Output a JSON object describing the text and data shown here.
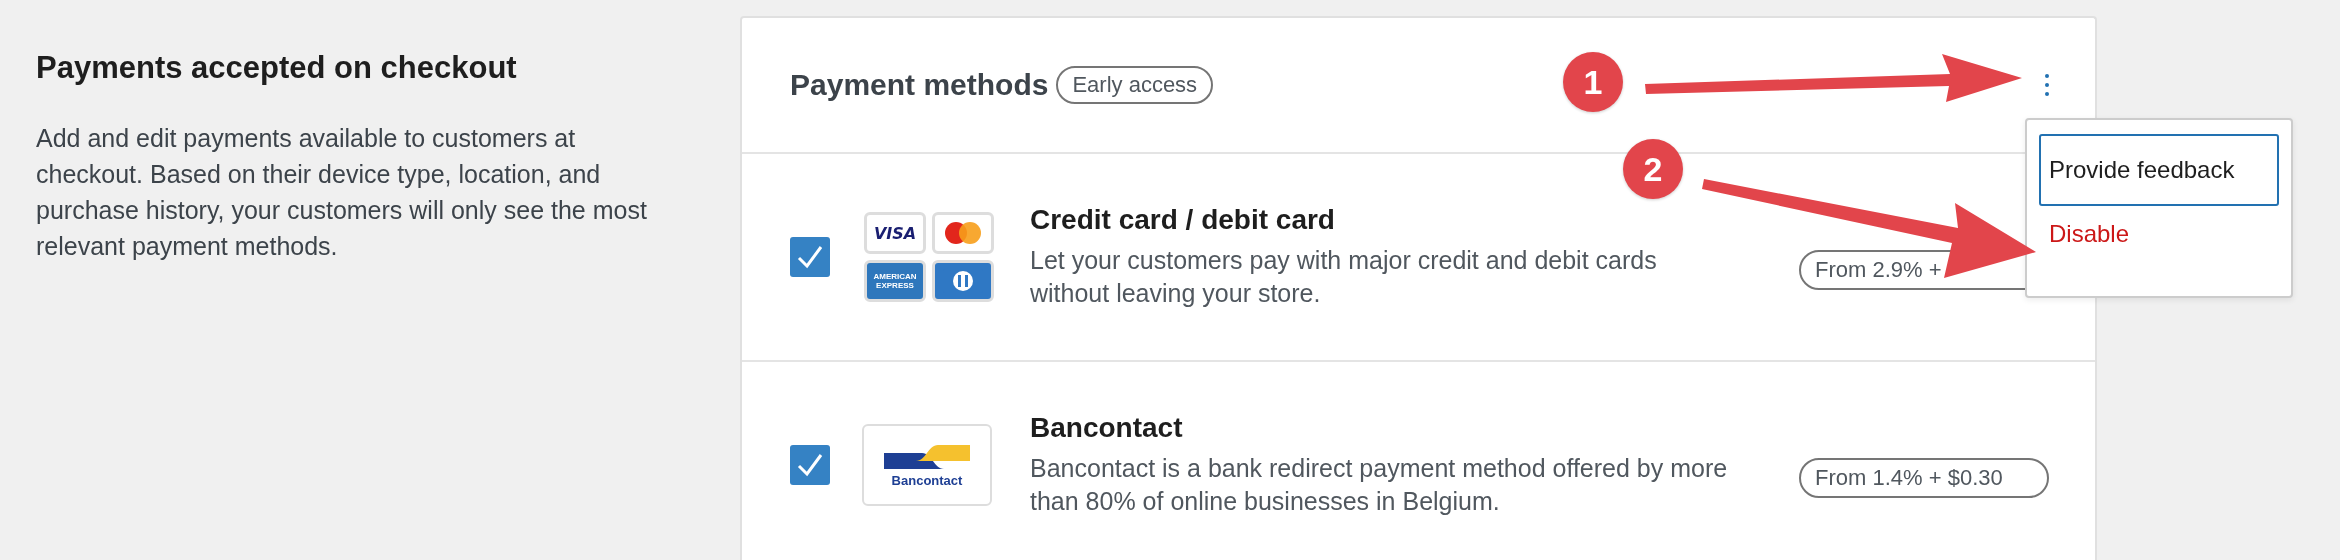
{
  "intro": {
    "title": "Payments accepted on checkout",
    "description": "Add and edit payments available to customers at checkout. Based on their device type, location, and purchase history, your customers will only see the most relevant payment methods."
  },
  "card": {
    "title": "Payment methods",
    "badge": "Early access",
    "methods": [
      {
        "name": "Credit card / debit card",
        "description": "Let your customers pay with major credit and debit cards without leaving your store.",
        "fee": "From 2.9% +",
        "checked": true,
        "logo": {
          "kind": "cards",
          "visa": "VISA",
          "amex": [
            "AMERICAN",
            "EXPRESS"
          ]
        }
      },
      {
        "name": "Bancontact",
        "description": "Bancontact is a bank redirect payment method offered by more than 80% of online businesses in Belgium.",
        "fee": "From 1.4% + $0.30",
        "checked": true,
        "logo": {
          "kind": "bancontact",
          "text": "Bancontact"
        }
      }
    ]
  },
  "menu": {
    "items": [
      {
        "label": "Provide feedback",
        "kind": "focused"
      },
      {
        "label": "Disable",
        "kind": "danger"
      }
    ]
  },
  "annotations": [
    {
      "label": "1"
    },
    {
      "label": "2"
    }
  ]
}
